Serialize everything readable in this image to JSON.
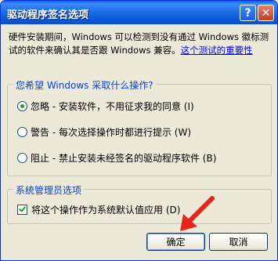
{
  "window": {
    "title": "驱动程序签名选项",
    "help_label": "?",
    "close_label": "✕"
  },
  "description": {
    "text": "硬件安装期间，Windows 可以检测到没有通过 Windows 徽标测试的软件来确认其是否跟 Windows 兼容。",
    "link": "这个测试的重要性"
  },
  "options_group": {
    "legend": "您希望 Windows 采取什么操作?",
    "options": [
      {
        "label": "忽略 - 安装软件，不用征求我的同意 (I)",
        "checked": true
      },
      {
        "label": "警告 - 每次选择操作时都进行提示 (W)",
        "checked": false
      },
      {
        "label": "阻止 - 禁止安装未经签名的驱动程序软件 (B)",
        "checked": false
      }
    ]
  },
  "admin_group": {
    "legend": "系统管理员选项",
    "checkbox_label": "将这个操作作为系统默认值应用 (D)",
    "checked": true
  },
  "buttons": {
    "ok": "确定",
    "cancel": "取消"
  },
  "colors": {
    "titlebar": "#0a57d8",
    "legend": "#0046d5",
    "arrow": "#e8231c"
  }
}
